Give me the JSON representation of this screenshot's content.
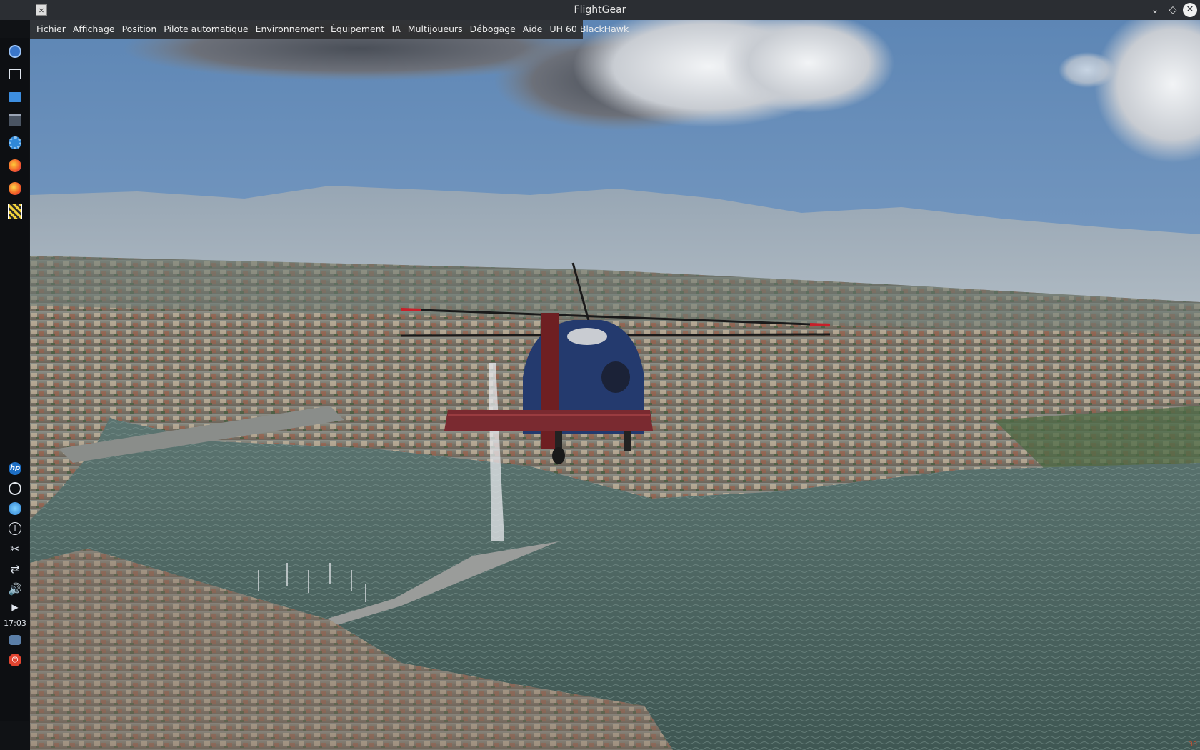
{
  "window": {
    "title": "FlightGear",
    "app_icon": "x-icon",
    "controls": [
      "minimize-icon",
      "maximize-icon",
      "close-icon"
    ]
  },
  "menubar": {
    "items": [
      {
        "label": "Fichier"
      },
      {
        "label": "Affichage"
      },
      {
        "label": "Position"
      },
      {
        "label": "Pilote automatique"
      },
      {
        "label": "Environnement"
      },
      {
        "label": "Équipement"
      },
      {
        "label": "IA"
      },
      {
        "label": "Multijoueurs"
      },
      {
        "label": "Débogage"
      },
      {
        "label": "Aide"
      },
      {
        "label": "UH 60 BlackHawk"
      }
    ]
  },
  "dock": {
    "top_icons": [
      "app-launcher-icon",
      "show-desktop-icon",
      "file-manager-icon",
      "system-settings-icon",
      "settings-gear-icon",
      "firefox-icon",
      "firefox-alt-icon",
      "flightgear-icon"
    ],
    "bottom_icons": [
      "hp-icon",
      "update-icon",
      "network-icon",
      "info-icon",
      "clipboard-scissors-icon",
      "usb-icon",
      "volume-icon",
      "expand-arrow-icon"
    ],
    "clock": "17:03",
    "tray_icons": [
      "storage-icon",
      "power-icon"
    ]
  },
  "hud": {
    "fps": "30"
  },
  "colors": {
    "titlebar": "#2b2e33",
    "menubar": "#2c2c2e",
    "dock": "#0d0f12",
    "sky_top": "#5d86b5",
    "water": "#4f6a66"
  }
}
